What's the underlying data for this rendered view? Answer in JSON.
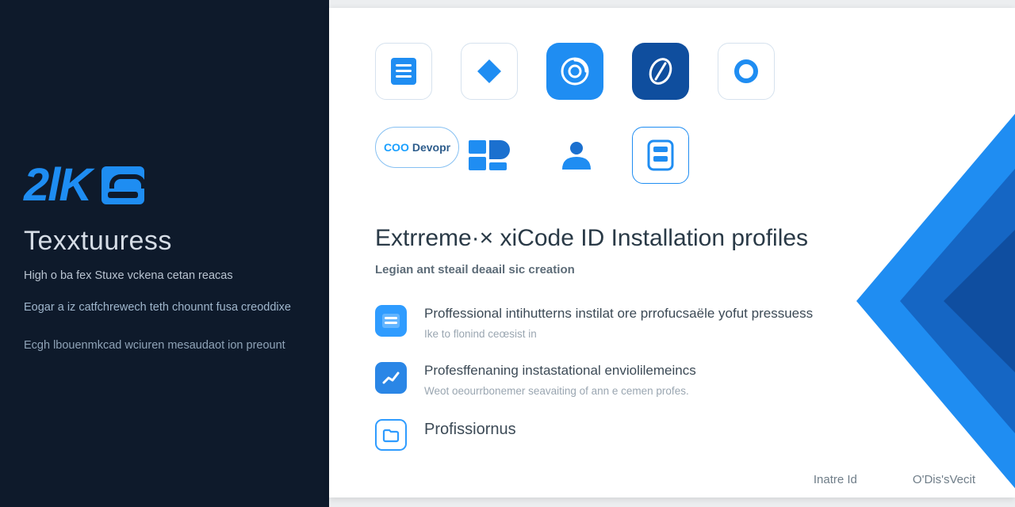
{
  "sidebar": {
    "logo_text": "2lK",
    "title": "Texxtuuress",
    "line1": "High o ba fex Stuxe vckena cetan reacas",
    "line2": "Eogar a iz catfchrewech teth chounnt fusa creoddixe",
    "line3": "Ecgh lbouenmkcad wciuren mesaudaot ion preount"
  },
  "icon_row1": {
    "tile1": "document-lines-icon",
    "tile2": "diamond-icon",
    "tile3": "spiral-icon",
    "tile4": "leaf-icon",
    "tile5": "ring-icon"
  },
  "icon_row2": {
    "chip_left": "COO",
    "chip_right": "Devopr",
    "tile2": "windows-icon",
    "tile3": "person-icon",
    "tile4": "list-panel-icon"
  },
  "headline": "Extrreme·× xiCode ID Installation profiles",
  "subhead": "Legian ant steail deaail sic creation",
  "features": [
    {
      "icon": "card-icon",
      "title": "Proffessional intihutterns instilat ore prrofucsaële yofut pressuess",
      "desc": "Ike to flonind ceœsist in"
    },
    {
      "icon": "chart-up-icon",
      "title": "Profesffenaning instastational enviolilemeincs",
      "desc": "Weot oeourrbonemer seavaiting of ann e cemen profes."
    },
    {
      "icon": "folder-open-icon",
      "title": "Profissiornus",
      "desc": ""
    }
  ],
  "footer": {
    "left": "Inatre Id",
    "right": "O'Dis'sVecit"
  },
  "colors": {
    "sidebar_bg": "#0e1a2b",
    "accent": "#1e8df2",
    "accent_mid": "#1b70cf",
    "accent_deep": "#0f4e9e"
  }
}
